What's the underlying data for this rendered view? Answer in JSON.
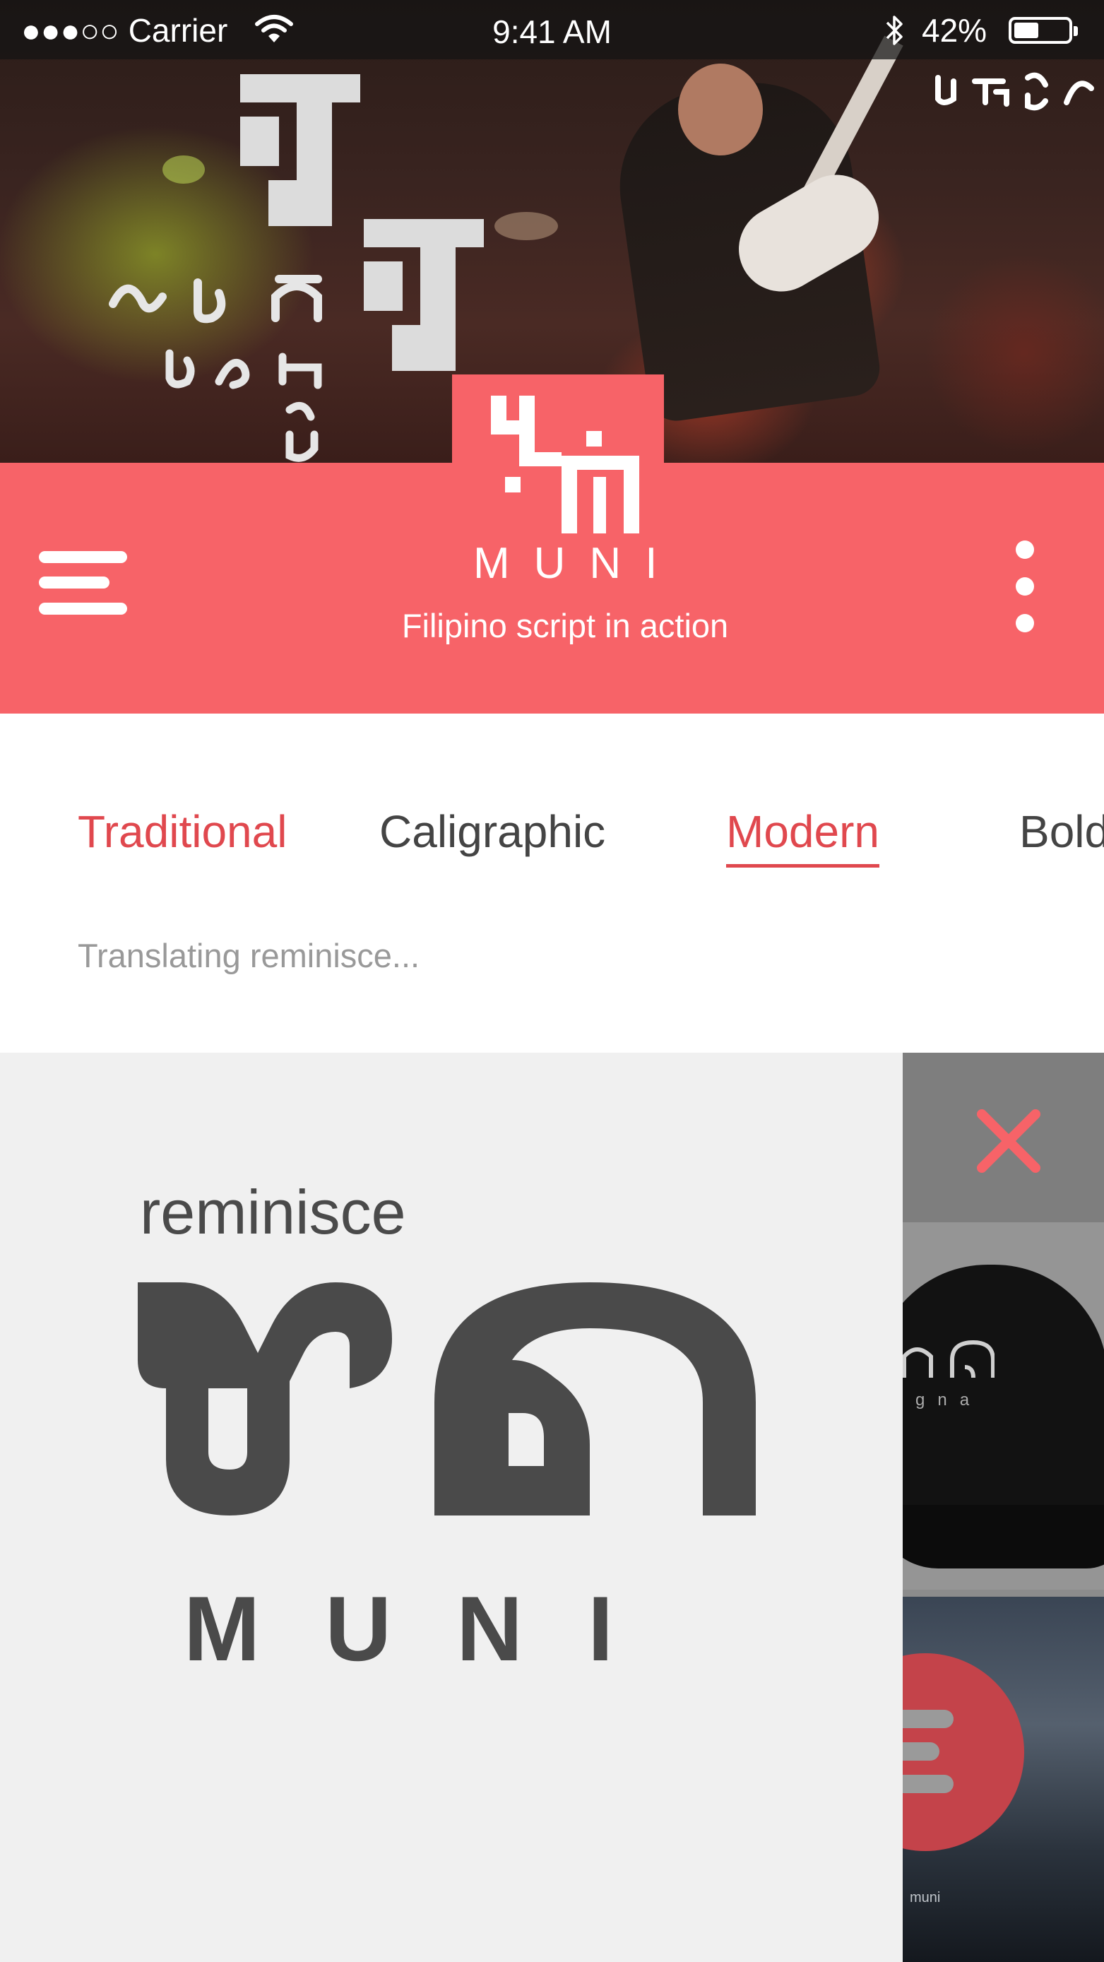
{
  "status_bar": {
    "carrier": "●●●○○ Carrier",
    "time": "9:41 AM",
    "battery": "42%",
    "icons": [
      "wifi-icon",
      "bluetooth-icon",
      "battery-icon"
    ]
  },
  "header": {
    "logo_word": "MUNI",
    "tagline": "Filipino script in action",
    "icons": [
      "hamburger-menu-icon",
      "more-vertical-icon"
    ],
    "color": "#f76368"
  },
  "tabs": [
    {
      "label": "Traditional"
    },
    {
      "label": "Caligraphic"
    },
    {
      "label": "Modern"
    },
    {
      "label": "Bold"
    }
  ],
  "status": "Translating reminisce...",
  "result": {
    "word": "reminisce",
    "logo_word": "MUNI"
  },
  "side_panel": {
    "cap_text": "gna",
    "poster_text": "muni",
    "icons": [
      "close-icon",
      "fab-menu-icon"
    ]
  },
  "colors": {
    "accent": "#f76368",
    "tab_active": "#e0484e",
    "text_dark": "#4a4a4a"
  }
}
